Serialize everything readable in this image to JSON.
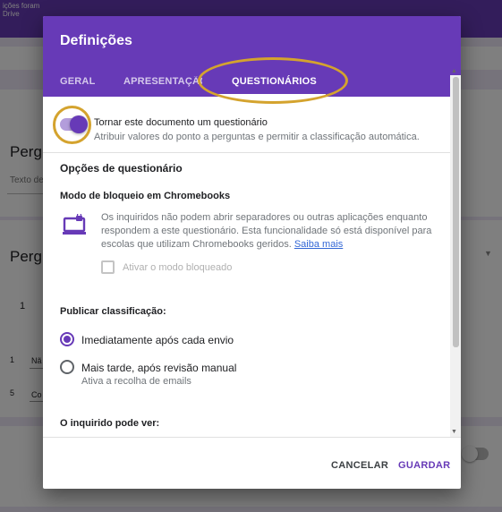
{
  "background": {
    "toast_text_line1": "ições foram",
    "toast_text_line2": "Drive",
    "question1_title": "Pergu",
    "question1_subtitle": "Texto de",
    "question2_title": "Pergu",
    "scale_start": "1",
    "row1_number": "1",
    "row1_text": "Nã",
    "row2_number": "5",
    "row2_text": "Co"
  },
  "dialog": {
    "title": "Definições",
    "tabs": [
      {
        "label": "GERAL",
        "active": false
      },
      {
        "label": "APRESENTAÇÃO",
        "active": false
      },
      {
        "label": "QUESTIONÁRIOS",
        "active": true
      }
    ],
    "quiz_toggle": {
      "label": "Tornar este documento um questionário",
      "description": "Atribuir valores do ponto a perguntas e permitir a classificação automática.",
      "checked": true
    },
    "section_title": "Opções de questionário",
    "lock_mode": {
      "title": "Modo de bloqueio em Chromebooks",
      "description": "Os inquiridos não podem abrir separadores ou outras aplicações enquanto respondem a este questionário. Esta funcionalidade só está disponível para escolas que utilizam Chromebooks geridos.",
      "link": "Saiba mais",
      "checkbox_label": "Ativar o modo bloqueado"
    },
    "publish": {
      "title": "Publicar classificação:",
      "options": [
        {
          "label": "Imediatamente após cada envio",
          "checked": true
        },
        {
          "label": "Mais tarde, após revisão manual",
          "sub": "Ativa a recolha de emails",
          "checked": false
        }
      ]
    },
    "respondent_can_see": "O inquirido pode ver:",
    "buttons": {
      "cancel": "CANCELAR",
      "save": "GUARDAR"
    }
  },
  "colors": {
    "brand_purple": "#673ab7",
    "highlight_ring": "#d4a32e",
    "link_blue": "#3367d6"
  }
}
